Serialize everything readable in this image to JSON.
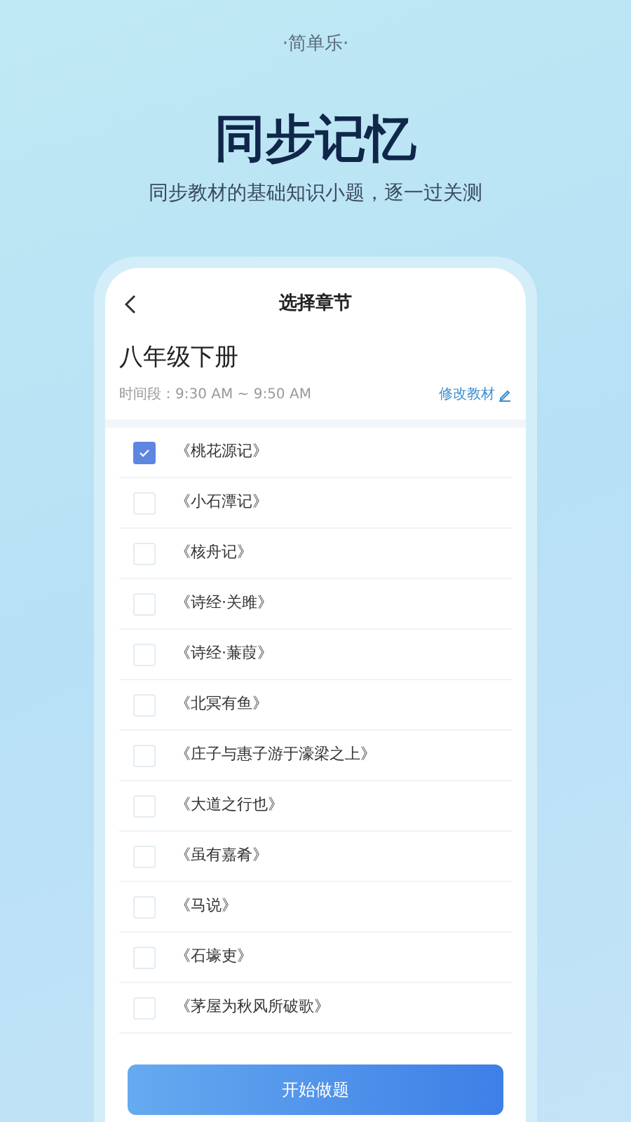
{
  "brand": "·简单乐·",
  "headline": "同步记忆",
  "subtitle": "同步教材的基础知识小题，逐一过关测",
  "screen": {
    "title": "选择章节",
    "book": "八年级下册",
    "time": "时间段：9:30 AM ~ 9:50 AM",
    "change_link": "修改教材",
    "chapters": [
      {
        "label": "《桃花源记》",
        "checked": true
      },
      {
        "label": "《小石潭记》",
        "checked": false
      },
      {
        "label": "《核舟记》",
        "checked": false
      },
      {
        "label": "《诗经·关雎》",
        "checked": false
      },
      {
        "label": "《诗经·蒹葭》",
        "checked": false
      },
      {
        "label": "《北冥有鱼》",
        "checked": false
      },
      {
        "label": "《庄子与惠子游于濠梁之上》",
        "checked": false
      },
      {
        "label": "《大道之行也》",
        "checked": false
      },
      {
        "label": "《虽有嘉肴》",
        "checked": false
      },
      {
        "label": "《马说》",
        "checked": false
      },
      {
        "label": "《石壕吏》",
        "checked": false
      },
      {
        "label": "《茅屋为秋风所破歌》",
        "checked": false
      }
    ],
    "start_button": "开始做题"
  }
}
